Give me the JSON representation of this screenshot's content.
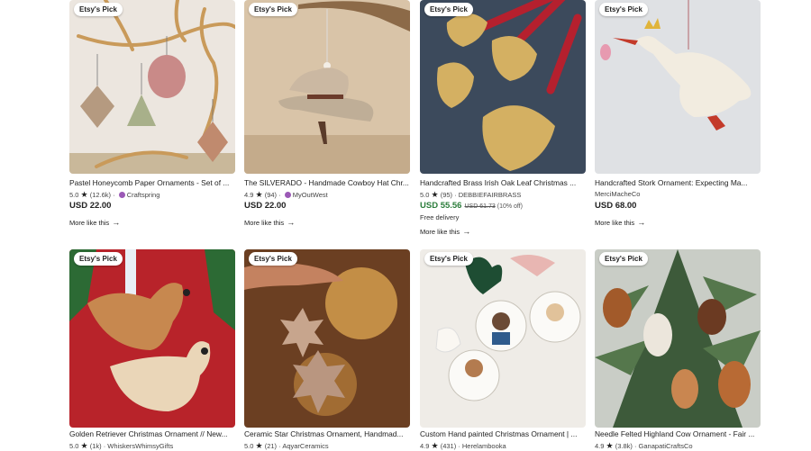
{
  "badge": "Etsy's Pick",
  "more_label": "More like this",
  "arrow_glyph": "→",
  "star_glyph": "★",
  "row1": [
    {
      "title": "Pastel Honeycomb Paper Ornaments - Set of ...",
      "rating": "5.0",
      "reviews": "(12.6k)",
      "shop": "Craftspring",
      "price": "USD 22.00"
    },
    {
      "title": "The SILVERADO - Handmade Cowboy Hat Chr...",
      "rating": "4.9",
      "reviews": "(94)",
      "shop": "MyOutWest",
      "price": "USD 22.00"
    },
    {
      "title": "Handcrafted Brass Irish Oak Leaf Christmas ...",
      "rating": "5.0",
      "reviews": "(95)",
      "shop": "DEBBIEFAIRBRASS",
      "price": "USD 55.56",
      "original": "USD 61.73",
      "discount": "(10% off)",
      "delivery": "Free delivery"
    },
    {
      "title": "Handcrafted Stork Ornament: Expecting Ma...",
      "shop": "MerciMacheCo",
      "price": "USD 68.00"
    }
  ],
  "row2": [
    {
      "title": "Golden Retriever Christmas Ornament // New...",
      "rating": "5.0",
      "reviews": "(1k)",
      "shop": "WhiskersWhimsyGifts"
    },
    {
      "title": "Ceramic Star Christmas Ornament, Handmad...",
      "rating": "5.0",
      "reviews": "(21)",
      "shop": "AqyarCeramics"
    },
    {
      "title": "Custom Hand painted Christmas Ornament | ...",
      "rating": "4.9",
      "reviews": "(431)",
      "shop": "Herelambooka"
    },
    {
      "title": "Needle Felted Highland Cow Ornament - Fair ...",
      "rating": "4.9",
      "reviews": "(3.8k)",
      "shop": "GanapatiCraftsCo"
    }
  ]
}
